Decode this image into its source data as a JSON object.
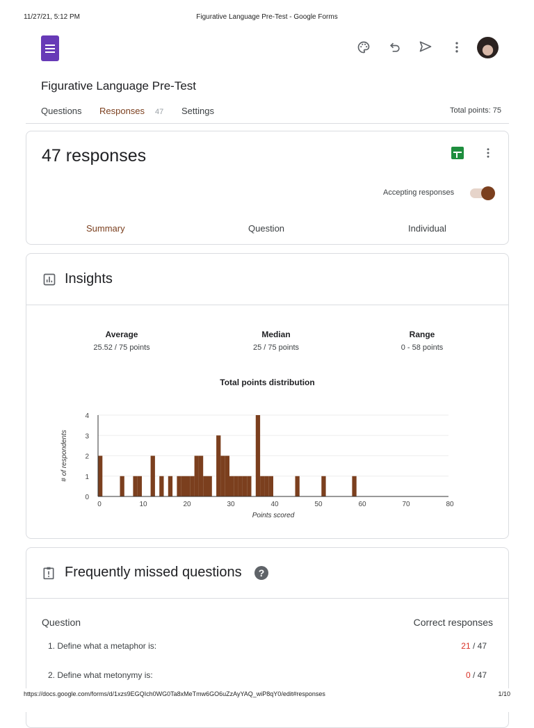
{
  "print_header": {
    "datetime": "11/27/21, 5:12 PM",
    "title": "Figurative Language Pre-Test - Google Forms"
  },
  "form": {
    "title": "Figurative Language Pre-Test",
    "total_points": "Total points: 75"
  },
  "tabs": [
    {
      "label": "Questions"
    },
    {
      "label": "Responses",
      "badge": "47"
    },
    {
      "label": "Settings"
    }
  ],
  "responses": {
    "count_label": "47 responses",
    "accepting_label": "Accepting responses",
    "accepting": true,
    "subtabs": [
      "Summary",
      "Question",
      "Individual"
    ]
  },
  "insights": {
    "title": "Insights",
    "stats": [
      {
        "label": "Average",
        "value": "25.52 / 75 points"
      },
      {
        "label": "Median",
        "value": "25 / 75 points"
      },
      {
        "label": "Range",
        "value": "0 - 58 points"
      }
    ]
  },
  "chart_data": {
    "type": "bar",
    "title": "Total points distribution",
    "xlabel": "Points scored",
    "ylabel": "# of respondents",
    "xlim": [
      0,
      80
    ],
    "ylim": [
      0,
      4
    ],
    "xticks": [
      "0",
      "10",
      "20",
      "30",
      "40",
      "50",
      "60",
      "70",
      "80"
    ],
    "yticks": [
      "0",
      "1",
      "2",
      "3",
      "4"
    ],
    "x": [
      0,
      5,
      8,
      9,
      12,
      14,
      16,
      18,
      19,
      20,
      21,
      22,
      23,
      24,
      25,
      27,
      28,
      29,
      30,
      31,
      32,
      33,
      34,
      36,
      37,
      38,
      39,
      45,
      51,
      58
    ],
    "values": [
      2,
      1,
      1,
      1,
      2,
      1,
      1,
      1,
      1,
      1,
      1,
      2,
      2,
      1,
      1,
      3,
      2,
      2,
      1,
      1,
      1,
      1,
      1,
      4,
      1,
      1,
      1,
      1,
      1,
      1
    ],
    "color": "#7b3f1e"
  },
  "missed": {
    "title": "Frequently missed questions",
    "col_question": "Question",
    "col_correct": "Correct responses",
    "rows": [
      {
        "q": "1. Define what a metaphor is:",
        "correct": "21",
        "total": " / 47"
      },
      {
        "q": "2. Define what metonymy is:",
        "correct": "0",
        "total": " / 47"
      }
    ]
  },
  "print_footer": {
    "url": "https://docs.google.com/forms/d/1xzs9EGQIch0WG0Ta8xMeTmw6GO6uZzAyYAQ_wiP8qY0/edit#responses",
    "page": "1/10"
  }
}
